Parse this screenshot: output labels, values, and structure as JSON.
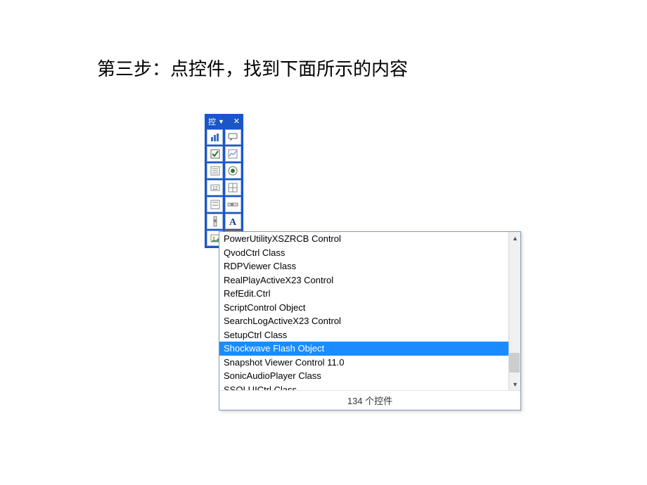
{
  "page": {
    "title": "第三步：点控件，找到下面所示的内容"
  },
  "toolbox": {
    "title": "控"
  },
  "listbox": {
    "items": [
      "PowerUtilityXSZRCB Control",
      "QvodCtrl Class",
      "RDPViewer Class",
      "RealPlayActiveX23 Control",
      "RefEdit.Ctrl",
      "ScriptControl Object",
      "SearchLogActiveX23 Control",
      "SetupCtrl Class",
      "Shockwave Flash Object",
      "Snapshot Viewer Control 11.0",
      "SonicAudioPlayer Class",
      "SSOLUICtrl Class"
    ],
    "selected_index": 8,
    "status": "134 个控件"
  }
}
